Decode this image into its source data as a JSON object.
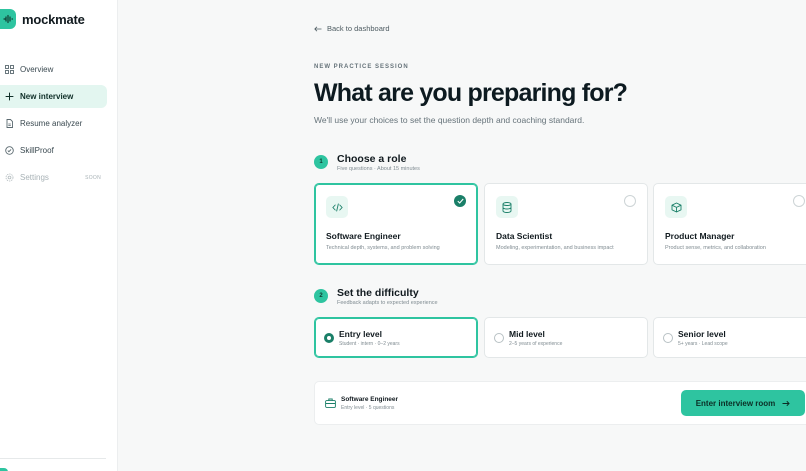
{
  "app": {
    "name": "mockmate",
    "accent": "#2ec4a0"
  },
  "sidebar": {
    "items": [
      {
        "label": "Overview",
        "icon": "grid-icon",
        "state": "normal"
      },
      {
        "label": "New interview",
        "icon": "plus-icon",
        "state": "active"
      },
      {
        "label": "Resume analyzer",
        "icon": "document-icon",
        "state": "normal"
      },
      {
        "label": "SkillProof",
        "icon": "check-circle-icon",
        "state": "normal"
      },
      {
        "label": "Settings",
        "icon": "gear-icon",
        "state": "disabled",
        "badge": "SOON"
      }
    ]
  },
  "main": {
    "back_label": "Back to dashboard",
    "eyebrow": "NEW PRACTICE SESSION",
    "title": "What are you preparing for?",
    "subtitle": "We'll use your choices to set the question depth and coaching standard.",
    "step1": {
      "number": "1",
      "title": "Choose a role",
      "sub": "Five questions · About 15 minutes"
    },
    "roles": [
      {
        "title": "Software Engineer",
        "desc": "Technical depth, systems, and problem solving",
        "icon": "code-icon",
        "selected": true
      },
      {
        "title": "Data Scientist",
        "desc": "Modeling, experimentation, and business impact",
        "icon": "database-icon",
        "selected": false
      },
      {
        "title": "Product Manager",
        "desc": "Product sense, metrics, and collaboration",
        "icon": "box-icon",
        "selected": false
      }
    ],
    "step2": {
      "number": "2",
      "title": "Set the difficulty",
      "sub": "Feedback adapts to expected experience"
    },
    "levels": [
      {
        "title": "Entry level",
        "desc": "Student · intern · 0–2 years",
        "selected": true
      },
      {
        "title": "Mid level",
        "desc": "2–5 years of experience",
        "selected": false
      },
      {
        "title": "Senior level",
        "desc": "5+ years · Lead scope",
        "selected": false
      }
    ],
    "summary": {
      "title": "Software Engineer",
      "sub": "Entry level · 5 questions",
      "icon": "briefcase-icon"
    },
    "enter_label": "Enter interview room"
  }
}
